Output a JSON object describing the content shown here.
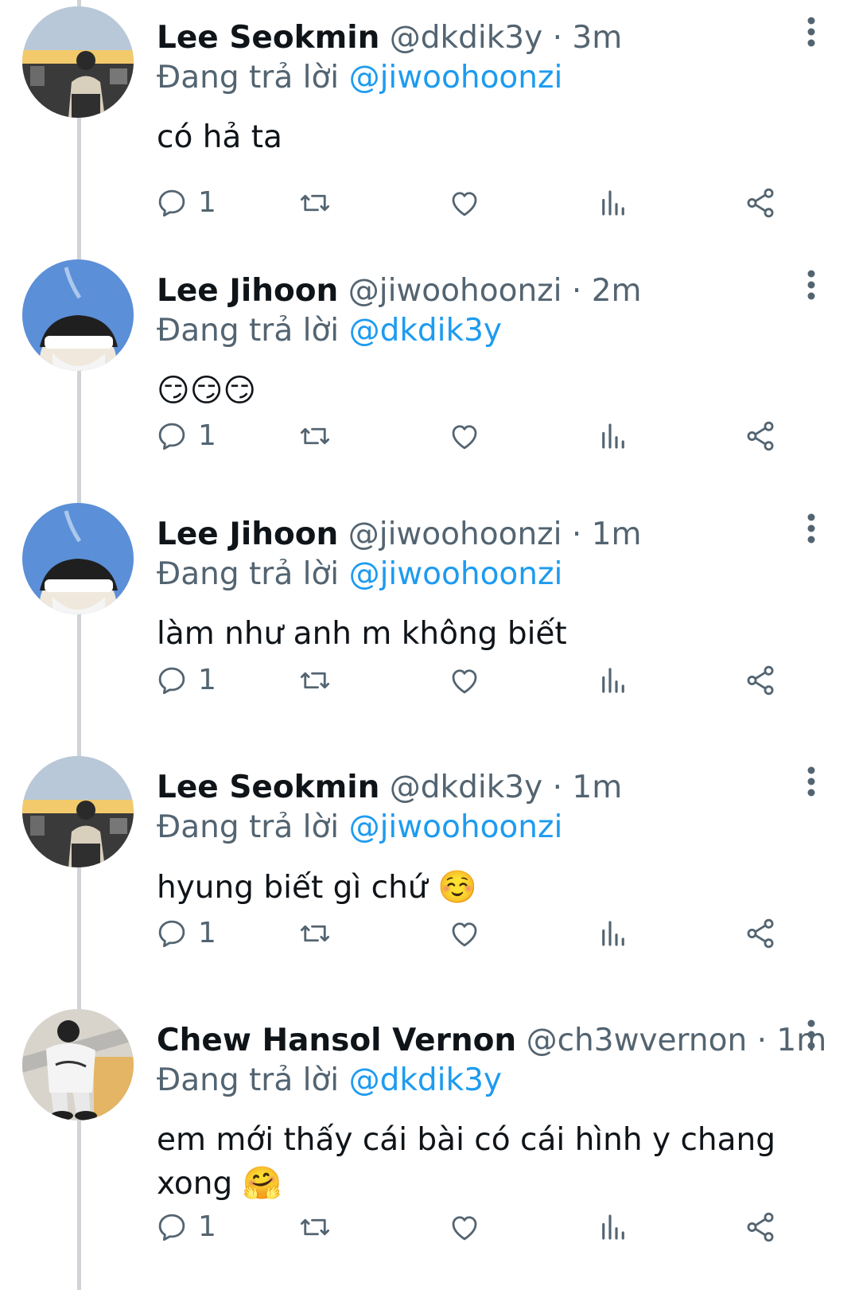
{
  "reply_prefix": "Đang trả lời",
  "tweets": [
    {
      "name": "Lee Seokmin",
      "handle": "@dkdik3y",
      "dot": "·",
      "time": "3m",
      "reply_to": "@jiwoohoonzi",
      "text": "có hả ta",
      "emoji": "",
      "reply_count": "1",
      "avatar": "sunset-rooftop"
    },
    {
      "name": "Lee Jihoon",
      "handle": "@jiwoohoonzi",
      "dot": "·",
      "time": "2m",
      "reply_to": "@dkdik3y",
      "text": "",
      "emoji": "😏😏😏",
      "reply_count": "1",
      "avatar": "sky-selfie"
    },
    {
      "name": "Lee Jihoon",
      "handle": "@jiwoohoonzi",
      "dot": "·",
      "time": "1m",
      "reply_to": "@jiwoohoonzi",
      "text": "làm như anh m không biết",
      "emoji": "",
      "reply_count": "1",
      "avatar": "sky-selfie"
    },
    {
      "name": "Lee Seokmin",
      "handle": "@dkdik3y",
      "dot": "·",
      "time": "1m",
      "reply_to": "@jiwoohoonzi",
      "text": "hyung biết gì chứ",
      "emoji": "☺️",
      "reply_count": "1",
      "avatar": "sunset-rooftop"
    },
    {
      "name": "Chew Hansol Vernon",
      "handle": "@ch3wvernon",
      "dot": "·",
      "time": "1m",
      "reply_to": "@dkdik3y",
      "text": "em mới thấy cái bài có cái hình y chang xong",
      "emoji": "🤗",
      "reply_count": "1",
      "avatar": "stairs-photo"
    }
  ],
  "icons": [
    "reply-icon",
    "retweet-icon",
    "like-icon",
    "views-icon",
    "share-icon",
    "more-icon"
  ],
  "colors": {
    "link": "#1d9bf0",
    "secondary": "#536471",
    "text": "#0f1419",
    "thread_line": "#d0d4d8"
  }
}
